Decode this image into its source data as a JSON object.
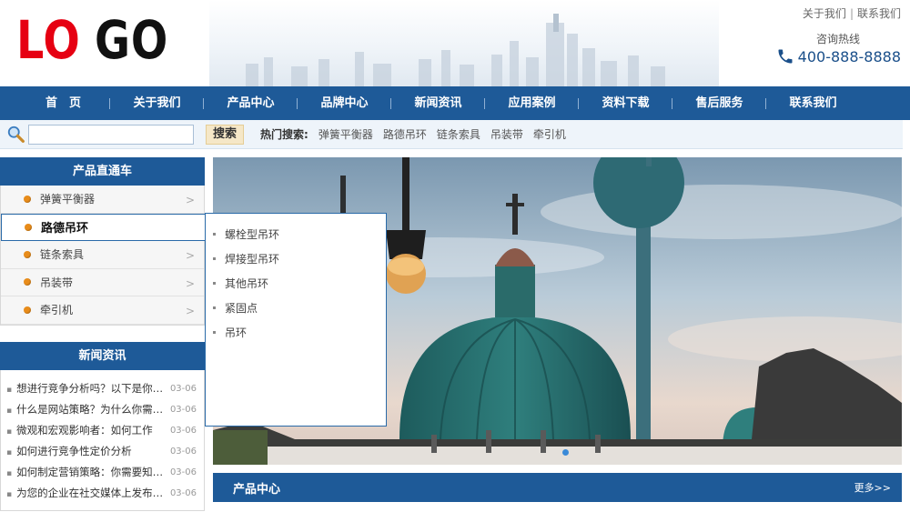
{
  "header": {
    "logo": {
      "part1": "LO",
      "part2": "GO"
    },
    "top_links": [
      "关于我们",
      "联系我们"
    ],
    "hotline_label": "咨询热线",
    "hotline_number": "400-888-8888"
  },
  "nav": [
    "首　页",
    "关于我们",
    "产品中心",
    "品牌中心",
    "新闻资讯",
    "应用案例",
    "资料下载",
    "售后服务",
    "联系我们"
  ],
  "search": {
    "placeholder": "",
    "button_label": "搜索",
    "hot_label": "热门搜索:",
    "hot_links": [
      "弹簧平衡器",
      "路德吊环",
      "链条索具",
      "吊装带",
      "牵引机"
    ]
  },
  "product_nav": {
    "title": "产品直通车",
    "items": [
      {
        "label": "弹簧平衡器",
        "active": false
      },
      {
        "label": "路德吊环",
        "active": true
      },
      {
        "label": "链条索具",
        "active": false
      },
      {
        "label": "吊装带",
        "active": false
      },
      {
        "label": "牵引机",
        "active": false
      }
    ],
    "flyout_items": [
      "螺栓型吊环",
      "焊接型吊环",
      "其他吊环",
      "紧固点",
      "吊环"
    ]
  },
  "news": {
    "title": "新闻资讯",
    "items": [
      {
        "title": "想进行竞争分析吗？以下是你…",
        "date": "03-06"
      },
      {
        "title": "什么是网站策略？为什么你需…",
        "date": "03-06"
      },
      {
        "title": "微观和宏观影响者：如何工作",
        "date": "03-06"
      },
      {
        "title": "如何进行竞争性定价分析",
        "date": "03-06"
      },
      {
        "title": "如何制定营销策略：你需要知…",
        "date": "03-06"
      },
      {
        "title": "为您的企业在社交媒体上发布…",
        "date": "03-06"
      }
    ]
  },
  "banner": {
    "icon": "city-dome-photo"
  },
  "product_center": {
    "title": "产品中心",
    "more": "更多>>"
  },
  "colors": {
    "nav_blue": "#1e5a98",
    "logo_red": "#e60012"
  }
}
